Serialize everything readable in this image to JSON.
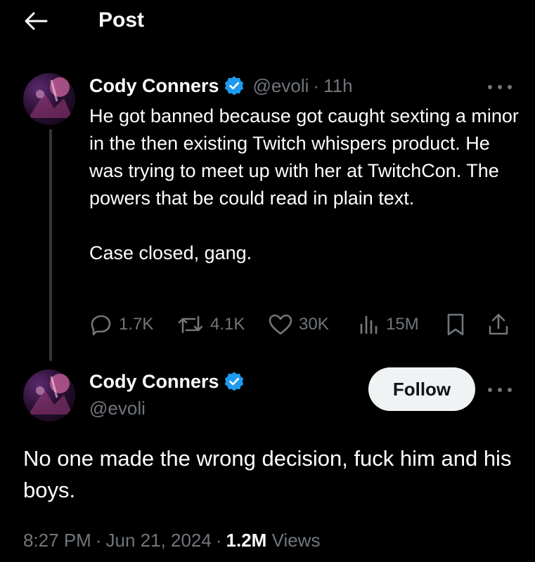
{
  "header": {
    "title": "Post",
    "back_icon": "arrow-left-icon"
  },
  "colors": {
    "background": "#000000",
    "text": "#ffffff",
    "muted": "#71767b",
    "verified": "#1d9bf0",
    "follow_bg": "#eff3f4"
  },
  "parent_tweet": {
    "author_name": "Cody Conners",
    "handle": "@evoli",
    "separator": "·",
    "time": "11h",
    "text": "He got banned because got caught sexting a minor in the then existing Twitch whispers product. He was trying to meet up with her at TwitchCon. The powers that be could read in plain text.\n\nCase closed, gang.",
    "replies": "1.7K",
    "reposts": "4.1K",
    "likes": "30K",
    "views": "15M"
  },
  "main_tweet": {
    "author_name": "Cody Conners",
    "handle": "@evoli",
    "follow_label": "Follow",
    "text": "No one made the wrong decision, fuck him and his boys.",
    "time": "8:27 PM",
    "date": "Jun 21, 2024",
    "views_count": "1.2M",
    "views_label": "Views",
    "separator": "·"
  }
}
